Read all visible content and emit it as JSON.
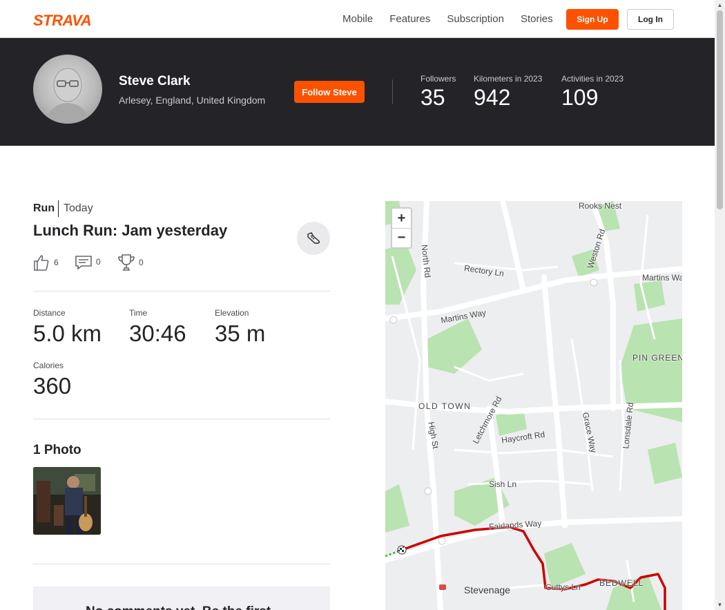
{
  "nav": {
    "logo": "STRAVA",
    "links": [
      "Mobile",
      "Features",
      "Subscription",
      "Stories"
    ],
    "signup": "Sign Up",
    "login": "Log In"
  },
  "athlete": {
    "name": "Steve Clark",
    "location": "Arlesey, England, United Kingdom",
    "follow": "Follow Steve",
    "stats": [
      {
        "label": "Followers",
        "value": "35"
      },
      {
        "label": "Kilometers in 2023",
        "value": "942"
      },
      {
        "label": "Activities in 2023",
        "value": "109"
      }
    ]
  },
  "activity": {
    "type": "Run",
    "date": "Today",
    "title": "Lunch Run: Jam yesterday",
    "kudos": "6",
    "comments": "0",
    "achievements": "0",
    "metrics": {
      "distance": {
        "label": "Distance",
        "value": "5.0 km"
      },
      "time": {
        "label": "Time",
        "value": "30:46"
      },
      "elevation": {
        "label": "Elevation",
        "value": "35 m"
      },
      "calories": {
        "label": "Calories",
        "value": "360"
      }
    },
    "photos_title": "1 Photo",
    "no_comments": "No comments yet. Be the first"
  },
  "map": {
    "zoom_in": "+",
    "zoom_out": "−",
    "labels": {
      "rooks_nest": "Rooks Nest",
      "weston_rd": "Weston Rd",
      "north_rd": "North Rd",
      "rectory_ln": "Rectory Ln",
      "martins_way_e": "Martins Wa",
      "martins_way": "Martins Way",
      "pin_green": "PIN GREEN",
      "old_town": "OLD TOWN",
      "letchmore_rd": "Letchmore Rd",
      "high_st": "High St",
      "haycroft_rd": "Haycroft Rd",
      "grace_way": "Grace Way",
      "lonsdale_rd": "Lonsdale Rd",
      "sish_ln": "Sish Ln",
      "fairlands_way": "Fairlands Way",
      "stevenage": "Stevenage",
      "cuttys_ln": "Cuttys Ln",
      "bedwell": "BEDWELL"
    },
    "route_color": "#cc0000"
  },
  "colors": {
    "brand": "#fc5200",
    "banner": "#242428"
  }
}
